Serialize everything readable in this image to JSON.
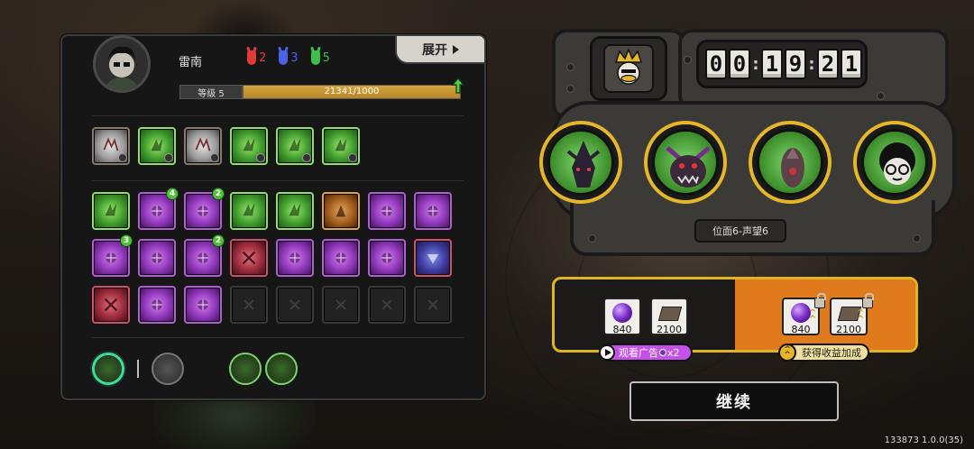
{
  "player": {
    "name": "雷南",
    "level_label": "等级 5",
    "xp_text": "21341/1000",
    "xp_fill": 1.0,
    "expand_label": "展开",
    "stats": [
      {
        "icon": "red-mask-icon",
        "color": "#e03a3a",
        "value": "2"
      },
      {
        "icon": "blue-mask-icon",
        "color": "#4a62e8",
        "value": "3"
      },
      {
        "icon": "green-mask-icon",
        "color": "#3fbf4a",
        "value": "5"
      }
    ]
  },
  "skills": {
    "row1": [
      "w",
      "g",
      "w",
      "g",
      "g",
      "g"
    ],
    "row2": [
      {
        "c": "g",
        "badge": ""
      },
      {
        "c": "p",
        "badge": "4"
      },
      {
        "c": "p",
        "badge": "2"
      },
      {
        "c": "g",
        "badge": ""
      },
      {
        "c": "g",
        "badge": ""
      },
      {
        "c": "o",
        "badge": ""
      },
      {
        "c": "p",
        "badge": ""
      },
      {
        "c": "p",
        "badge": ""
      }
    ],
    "row3": [
      {
        "c": "p",
        "badge": "3"
      },
      {
        "c": "p",
        "badge": ""
      },
      {
        "c": "p",
        "badge": "2"
      },
      {
        "c": "r",
        "badge": ""
      },
      {
        "c": "p",
        "badge": ""
      },
      {
        "c": "p",
        "badge": ""
      },
      {
        "c": "p",
        "badge": ""
      },
      {
        "c": "bl",
        "badge": ""
      }
    ],
    "row4": [
      {
        "c": "r",
        "badge": ""
      },
      {
        "c": "p",
        "badge": ""
      },
      {
        "c": "p",
        "badge": ""
      },
      {
        "c": "empty",
        "badge": ""
      },
      {
        "c": "empty",
        "badge": ""
      },
      {
        "c": "empty",
        "badge": ""
      },
      {
        "c": "empty",
        "badge": ""
      },
      {
        "c": "empty",
        "badge": ""
      }
    ]
  },
  "timer": {
    "h1": "0",
    "h2": "0",
    "m1": "1",
    "m2": "9",
    "s1": "2",
    "s2": "1"
  },
  "position_label": "位面6-声望6",
  "party": [
    "dark-beetle-portrait",
    "horned-demon-portrait",
    "armored-bug-portrait",
    "glasses-kid-portrait"
  ],
  "reward": {
    "base": [
      {
        "icon": "purple-orb-icon",
        "value": "840"
      },
      {
        "icon": "book-icon",
        "value": "2100"
      }
    ],
    "bonus": [
      {
        "icon": "purple-orb-icon",
        "value": "840"
      },
      {
        "icon": "book-icon",
        "value": "2100"
      }
    ],
    "ad_label": "观看广告",
    "ad_multiplier": "x2",
    "bonus_label": "获得收益加成"
  },
  "continue_label": "继续",
  "version": "133873 1.0.0(35)"
}
